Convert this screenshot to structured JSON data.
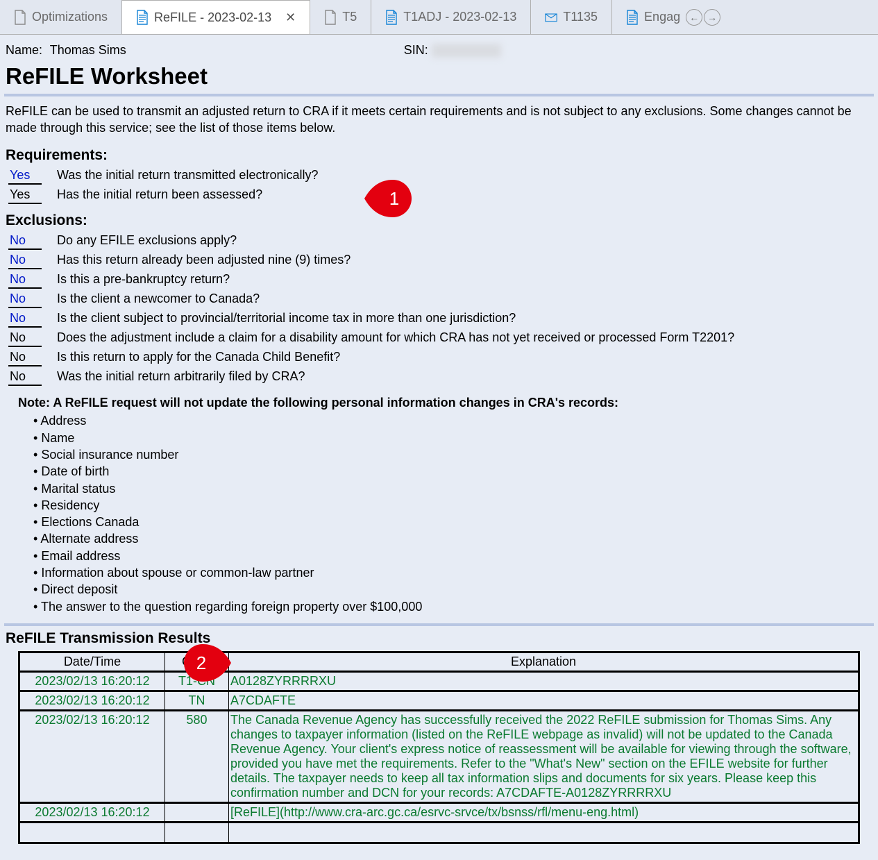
{
  "tabs": [
    {
      "label": "Optimizations",
      "icon": "doc-gray",
      "active": false,
      "close": false
    },
    {
      "label": "ReFILE - 2023-02-13",
      "icon": "doc-blue-lines",
      "active": true,
      "close": true
    },
    {
      "label": "T5",
      "icon": "doc-gray",
      "active": false,
      "close": false
    },
    {
      "label": "T1ADJ - 2023-02-13",
      "icon": "doc-blue-lines",
      "active": false,
      "close": false
    },
    {
      "label": "T1135",
      "icon": "folder-blue",
      "active": false,
      "close": false
    },
    {
      "label": "Engag",
      "icon": "doc-blue-lines",
      "active": false,
      "close": false
    }
  ],
  "header": {
    "name_label": "Name:",
    "name_value": "Thomas Sims",
    "sin_label": "SIN:",
    "title": "ReFILE Worksheet",
    "intro": "ReFILE can be used to transmit an adjusted return to CRA if it meets certain requirements and is not subject to any exclusions. Some changes cannot be made through this service; see the list of those items below."
  },
  "requirements": {
    "title": "Requirements:",
    "rows": [
      {
        "answer": "Yes",
        "link": true,
        "q": "Was the initial return transmitted electronically?"
      },
      {
        "answer": "Yes",
        "link": false,
        "q": "Has the initial return been assessed?"
      }
    ]
  },
  "exclusions": {
    "title": "Exclusions:",
    "rows": [
      {
        "answer": "No",
        "link": true,
        "q": "Do any EFILE exclusions apply?"
      },
      {
        "answer": "No",
        "link": true,
        "q": "Has this return already been adjusted nine (9) times?"
      },
      {
        "answer": "No",
        "link": true,
        "q": "Is this a pre-bankruptcy return?"
      },
      {
        "answer": "No",
        "link": true,
        "q": "Is the client a newcomer to Canada?"
      },
      {
        "answer": "No",
        "link": true,
        "q": "Is the client subject to provincial/territorial income tax in more than one jurisdiction?"
      },
      {
        "answer": "No",
        "link": false,
        "q": "Does the adjustment include a claim for a disability amount for which CRA has not yet received or processed Form T2201?"
      },
      {
        "answer": "No",
        "link": false,
        "q": "Is this return to apply for the Canada Child Benefit?"
      },
      {
        "answer": "No",
        "link": false,
        "q": "Was the initial return arbitrarily filed by CRA?"
      }
    ]
  },
  "note": {
    "label": "Note: A ReFILE request will not update the following personal information changes in CRA's records:",
    "items": [
      "Address",
      "Name",
      "Social insurance number",
      "Date of birth",
      "Marital status",
      "Residency",
      "Elections Canada",
      "Alternate address",
      "Email address",
      "Information about spouse or common-law partner",
      "Direct deposit",
      "The answer to the question regarding foreign property over $100,000"
    ]
  },
  "results": {
    "title": "ReFILE Transmission Results",
    "headers": {
      "dt": "Date/Time",
      "code": "Code",
      "exp": "Explanation"
    },
    "rows": [
      {
        "dt": "2023/02/13 16:20:12",
        "code": "T1-CN",
        "exp": "A0128ZYRRRRXU"
      },
      {
        "dt": "2023/02/13 16:20:12",
        "code": "TN",
        "exp": "A7CDAFTE"
      },
      {
        "dt": "2023/02/13 16:20:12",
        "code": "580",
        "exp": "The Canada Revenue Agency has successfully received the 2022 ReFILE submission for Thomas Sims. Any changes to taxpayer information (listed on the ReFILE webpage as invalid) will not be updated to the Canada Revenue Agency. Your client's express notice of reassessment will be available for viewing through the software, provided you have met the requirements. Refer to the \"What's New\" section on the EFILE website for further details. The taxpayer needs to keep all tax information slips and documents for six years. Please keep this confirmation number and DCN for your records: A7CDAFTE-A0128ZYRRRRXU"
      },
      {
        "dt": "2023/02/13 16:20:12",
        "code": "",
        "exp": "[ReFILE](http://www.cra-arc.gc.ca/esrvc-srvce/tx/bsnss/rfl/menu-eng.html)"
      }
    ]
  },
  "callouts": {
    "c1": "1",
    "c2": "2"
  }
}
